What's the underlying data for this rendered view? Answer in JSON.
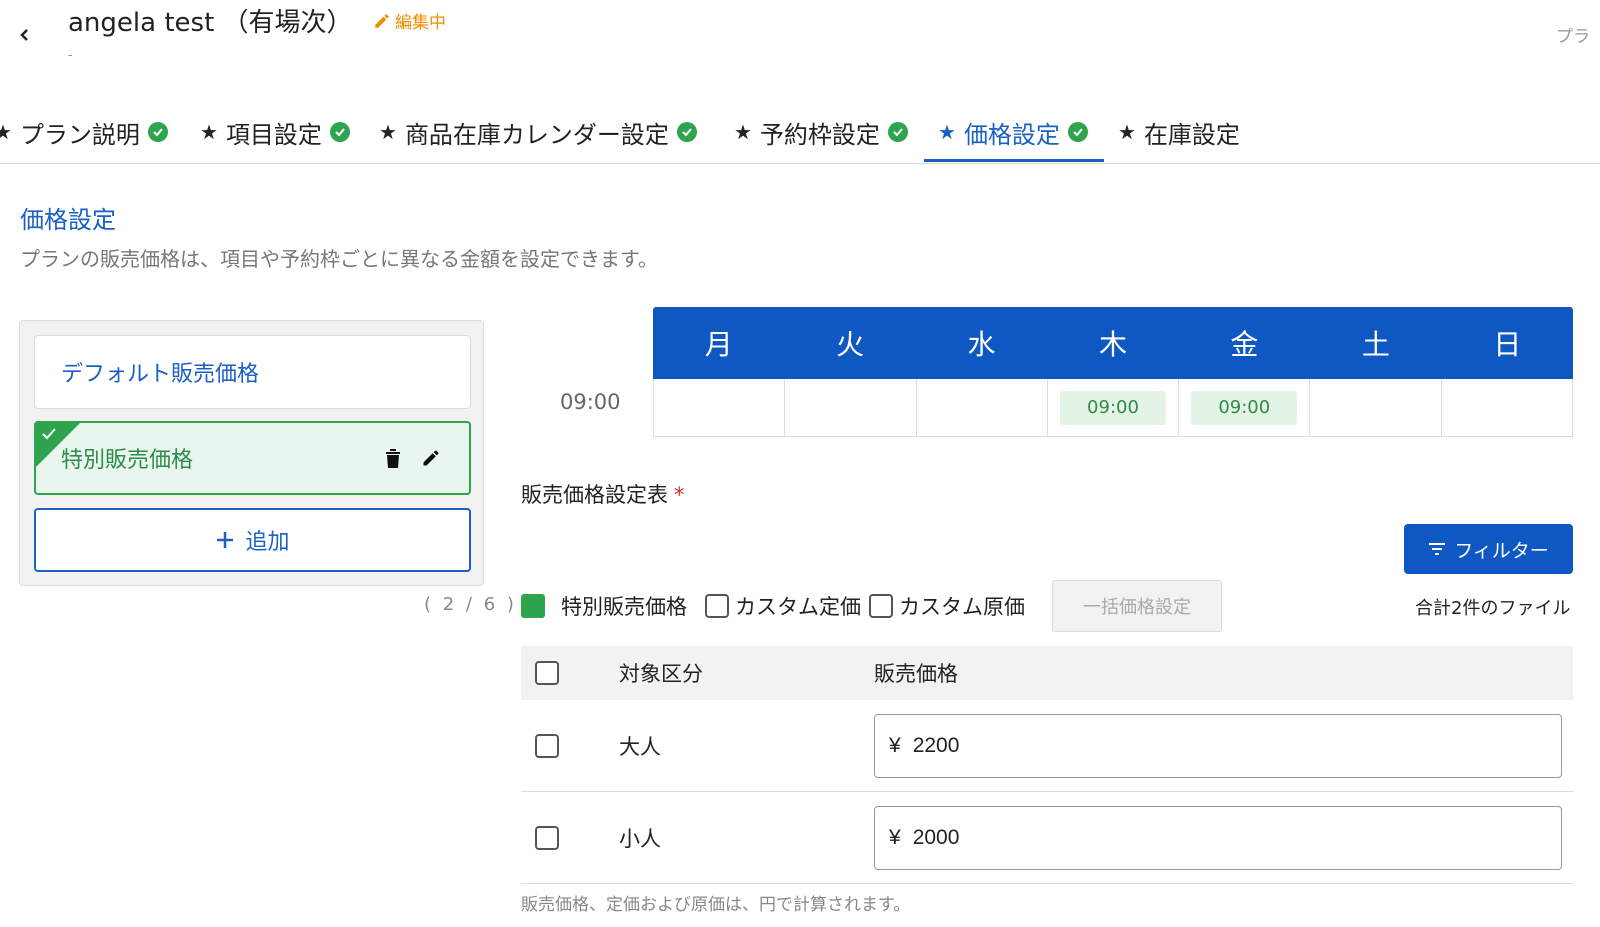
{
  "header": {
    "back_icon": "chevron-left-icon",
    "title": "angela test （有場次）",
    "subtitle": "-",
    "edit_status": "編集中",
    "edit_icon": "pencil-icon",
    "top_right": "プラ",
    "edit_color": "#f08c00"
  },
  "tabs": [
    {
      "label": "プラン説明",
      "done": true
    },
    {
      "label": "項目設定",
      "done": true
    },
    {
      "label": "商品在庫カレンダー設定",
      "done": true
    },
    {
      "label": "予約枠設定",
      "done": true
    },
    {
      "label": "価格設定",
      "done": true,
      "active": true
    },
    {
      "label": "在庫設定",
      "done": false
    }
  ],
  "tab_star": "★",
  "section": {
    "title": "価格設定",
    "description": "プランの販売価格は、項目や予約枠ごとに異なる金額を設定できます。"
  },
  "price_list": {
    "default_label": "デフォルト販売価格",
    "special_label": "特別販売価格",
    "add_label": "追加",
    "count": "( 2 / 6 )"
  },
  "calendar": {
    "days": [
      "月",
      "火",
      "水",
      "木",
      "金",
      "土",
      "日"
    ],
    "time_label": "09:00",
    "slots": [
      "",
      "",
      "",
      "09:00",
      "09:00",
      "",
      ""
    ]
  },
  "price_table": {
    "title": "販売価格設定表",
    "required_mark": "*",
    "filter_label": "フィルター",
    "legend_label": "特別販売価格",
    "custom_list_label": "カスタム定価",
    "custom_cost_label": "カスタム原価",
    "bulk_label": "一括価格設定",
    "total_label": "合計2件のファイル",
    "headers": {
      "target": "対象区分",
      "price": "販売価格"
    },
    "currency": "¥",
    "rows": [
      {
        "target": "大人",
        "price": "2200"
      },
      {
        "target": "小人",
        "price": "2000"
      }
    ],
    "footnote": "販売価格、定価および原価は、円で計算されます。"
  },
  "colors": {
    "primary": "#1a5fc4",
    "calendar_header": "#0f57c2",
    "success": "#2ea44f",
    "slot_bg": "#e3f4e6"
  }
}
